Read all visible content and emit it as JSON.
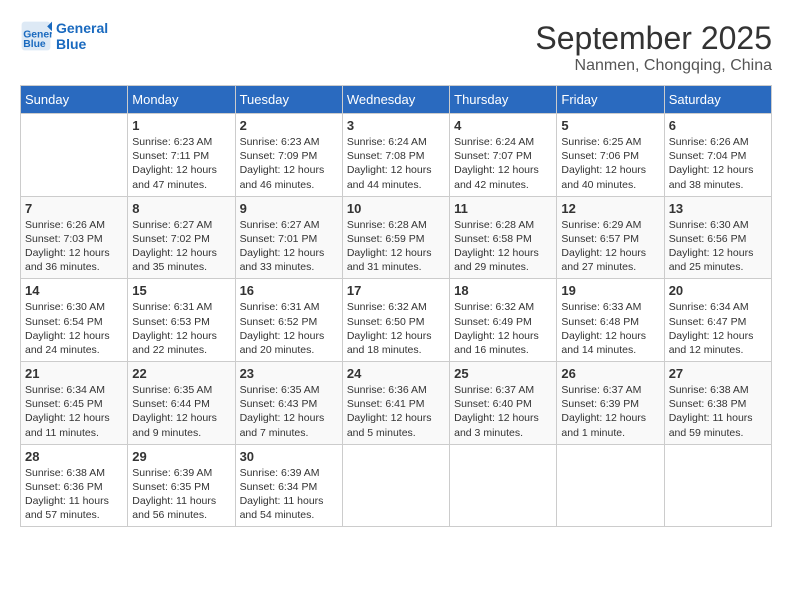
{
  "header": {
    "logo_line1": "General",
    "logo_line2": "Blue",
    "month": "September 2025",
    "location": "Nanmen, Chongqing, China"
  },
  "weekdays": [
    "Sunday",
    "Monday",
    "Tuesday",
    "Wednesday",
    "Thursday",
    "Friday",
    "Saturday"
  ],
  "weeks": [
    [
      {
        "day": "",
        "info": ""
      },
      {
        "day": "1",
        "info": "Sunrise: 6:23 AM\nSunset: 7:11 PM\nDaylight: 12 hours\nand 47 minutes."
      },
      {
        "day": "2",
        "info": "Sunrise: 6:23 AM\nSunset: 7:09 PM\nDaylight: 12 hours\nand 46 minutes."
      },
      {
        "day": "3",
        "info": "Sunrise: 6:24 AM\nSunset: 7:08 PM\nDaylight: 12 hours\nand 44 minutes."
      },
      {
        "day": "4",
        "info": "Sunrise: 6:24 AM\nSunset: 7:07 PM\nDaylight: 12 hours\nand 42 minutes."
      },
      {
        "day": "5",
        "info": "Sunrise: 6:25 AM\nSunset: 7:06 PM\nDaylight: 12 hours\nand 40 minutes."
      },
      {
        "day": "6",
        "info": "Sunrise: 6:26 AM\nSunset: 7:04 PM\nDaylight: 12 hours\nand 38 minutes."
      }
    ],
    [
      {
        "day": "7",
        "info": "Sunrise: 6:26 AM\nSunset: 7:03 PM\nDaylight: 12 hours\nand 36 minutes."
      },
      {
        "day": "8",
        "info": "Sunrise: 6:27 AM\nSunset: 7:02 PM\nDaylight: 12 hours\nand 35 minutes."
      },
      {
        "day": "9",
        "info": "Sunrise: 6:27 AM\nSunset: 7:01 PM\nDaylight: 12 hours\nand 33 minutes."
      },
      {
        "day": "10",
        "info": "Sunrise: 6:28 AM\nSunset: 6:59 PM\nDaylight: 12 hours\nand 31 minutes."
      },
      {
        "day": "11",
        "info": "Sunrise: 6:28 AM\nSunset: 6:58 PM\nDaylight: 12 hours\nand 29 minutes."
      },
      {
        "day": "12",
        "info": "Sunrise: 6:29 AM\nSunset: 6:57 PM\nDaylight: 12 hours\nand 27 minutes."
      },
      {
        "day": "13",
        "info": "Sunrise: 6:30 AM\nSunset: 6:56 PM\nDaylight: 12 hours\nand 25 minutes."
      }
    ],
    [
      {
        "day": "14",
        "info": "Sunrise: 6:30 AM\nSunset: 6:54 PM\nDaylight: 12 hours\nand 24 minutes."
      },
      {
        "day": "15",
        "info": "Sunrise: 6:31 AM\nSunset: 6:53 PM\nDaylight: 12 hours\nand 22 minutes."
      },
      {
        "day": "16",
        "info": "Sunrise: 6:31 AM\nSunset: 6:52 PM\nDaylight: 12 hours\nand 20 minutes."
      },
      {
        "day": "17",
        "info": "Sunrise: 6:32 AM\nSunset: 6:50 PM\nDaylight: 12 hours\nand 18 minutes."
      },
      {
        "day": "18",
        "info": "Sunrise: 6:32 AM\nSunset: 6:49 PM\nDaylight: 12 hours\nand 16 minutes."
      },
      {
        "day": "19",
        "info": "Sunrise: 6:33 AM\nSunset: 6:48 PM\nDaylight: 12 hours\nand 14 minutes."
      },
      {
        "day": "20",
        "info": "Sunrise: 6:34 AM\nSunset: 6:47 PM\nDaylight: 12 hours\nand 12 minutes."
      }
    ],
    [
      {
        "day": "21",
        "info": "Sunrise: 6:34 AM\nSunset: 6:45 PM\nDaylight: 12 hours\nand 11 minutes."
      },
      {
        "day": "22",
        "info": "Sunrise: 6:35 AM\nSunset: 6:44 PM\nDaylight: 12 hours\nand 9 minutes."
      },
      {
        "day": "23",
        "info": "Sunrise: 6:35 AM\nSunset: 6:43 PM\nDaylight: 12 hours\nand 7 minutes."
      },
      {
        "day": "24",
        "info": "Sunrise: 6:36 AM\nSunset: 6:41 PM\nDaylight: 12 hours\nand 5 minutes."
      },
      {
        "day": "25",
        "info": "Sunrise: 6:37 AM\nSunset: 6:40 PM\nDaylight: 12 hours\nand 3 minutes."
      },
      {
        "day": "26",
        "info": "Sunrise: 6:37 AM\nSunset: 6:39 PM\nDaylight: 12 hours\nand 1 minute."
      },
      {
        "day": "27",
        "info": "Sunrise: 6:38 AM\nSunset: 6:38 PM\nDaylight: 11 hours\nand 59 minutes."
      }
    ],
    [
      {
        "day": "28",
        "info": "Sunrise: 6:38 AM\nSunset: 6:36 PM\nDaylight: 11 hours\nand 57 minutes."
      },
      {
        "day": "29",
        "info": "Sunrise: 6:39 AM\nSunset: 6:35 PM\nDaylight: 11 hours\nand 56 minutes."
      },
      {
        "day": "30",
        "info": "Sunrise: 6:39 AM\nSunset: 6:34 PM\nDaylight: 11 hours\nand 54 minutes."
      },
      {
        "day": "",
        "info": ""
      },
      {
        "day": "",
        "info": ""
      },
      {
        "day": "",
        "info": ""
      },
      {
        "day": "",
        "info": ""
      }
    ]
  ]
}
